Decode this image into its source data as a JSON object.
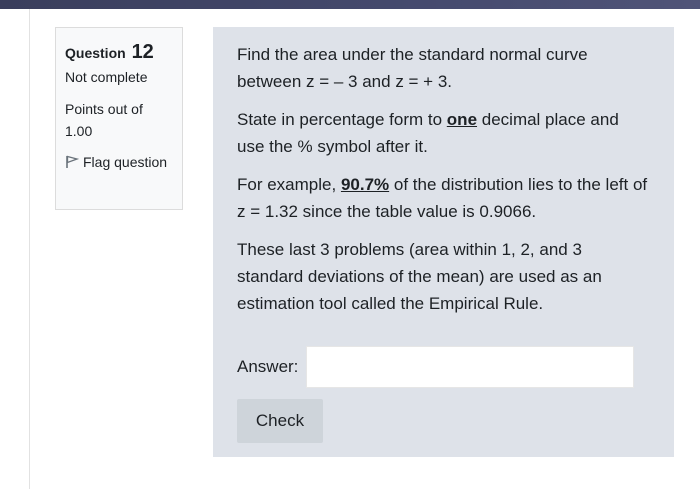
{
  "info": {
    "question_label": "Question",
    "question_number": "12",
    "state": "Not complete",
    "grade": "Points out of 1.00",
    "flag_label": "Flag question",
    "flag_icon": "flag-icon"
  },
  "question": {
    "p1": "Find the area under the standard normal curve between z = – 3 and z = + 3.",
    "p2_before": "State in percentage form to ",
    "p2_emph": "one",
    "p2_after": " decimal place and use the % symbol after it.",
    "p3_before": "For example, ",
    "p3_emph": "90.7%",
    "p3_after": " of the distribution lies to the left of z = 1.32 since the table value is 0.9066.",
    "p4": "These last 3 problems (area within 1, 2, and 3 standard deviations of the mean) are used as an estimation tool called the Empirical Rule."
  },
  "answer": {
    "label": "Answer:",
    "value": "",
    "placeholder": ""
  },
  "check_label": "Check",
  "colors": {
    "top_bar": "#454a6e",
    "info_bg": "#f8f9fa",
    "content_bg": "#dee2e9",
    "button_bg": "#ced4da"
  }
}
